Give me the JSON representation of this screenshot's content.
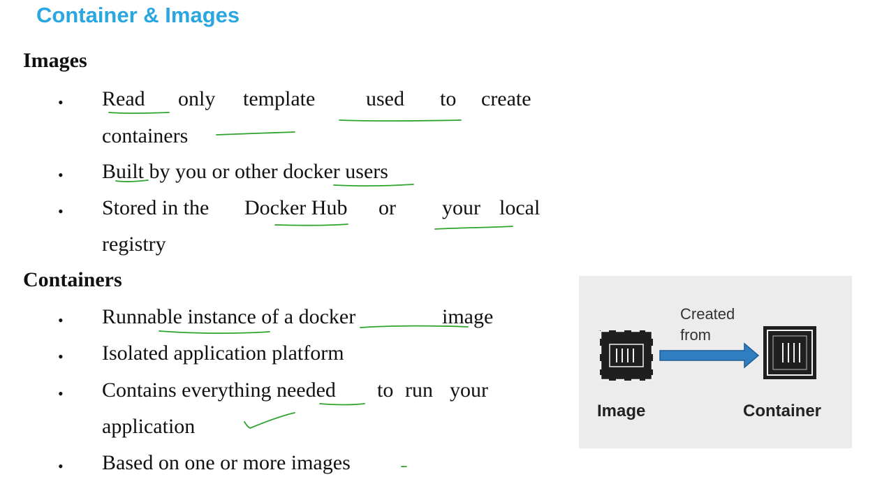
{
  "title": "Container & Images",
  "images_section": {
    "heading": "Images",
    "bullets": [
      {
        "words": [
          "Read",
          "only",
          "template",
          "used",
          "to",
          "create"
        ],
        "continuation": "containers"
      },
      {
        "text": "Built by you or other docker users"
      },
      {
        "words": [
          "Stored in the",
          "Docker Hub",
          "or",
          "your",
          "local"
        ],
        "continuation": "registry"
      }
    ]
  },
  "containers_section": {
    "heading": "Containers",
    "bullets": [
      {
        "text": "Runnable instance of a docker",
        "text_end": "image"
      },
      {
        "text": "Isolated application platform"
      },
      {
        "words": [
          "Contains everything needed",
          "to",
          "run",
          "your"
        ],
        "continuation": "application"
      },
      {
        "text": "Based on one or more images"
      }
    ]
  },
  "bullet_symbol": "•",
  "diagram": {
    "arrow_label": [
      "Created",
      "from"
    ],
    "image_caption": "Image",
    "container_caption": "Container"
  },
  "colors": {
    "title": "#2aa7e0",
    "annotation_ink": "#2ea32e",
    "arrow_fill": "#2f7ec1",
    "diagram_bg": "#ececec"
  }
}
